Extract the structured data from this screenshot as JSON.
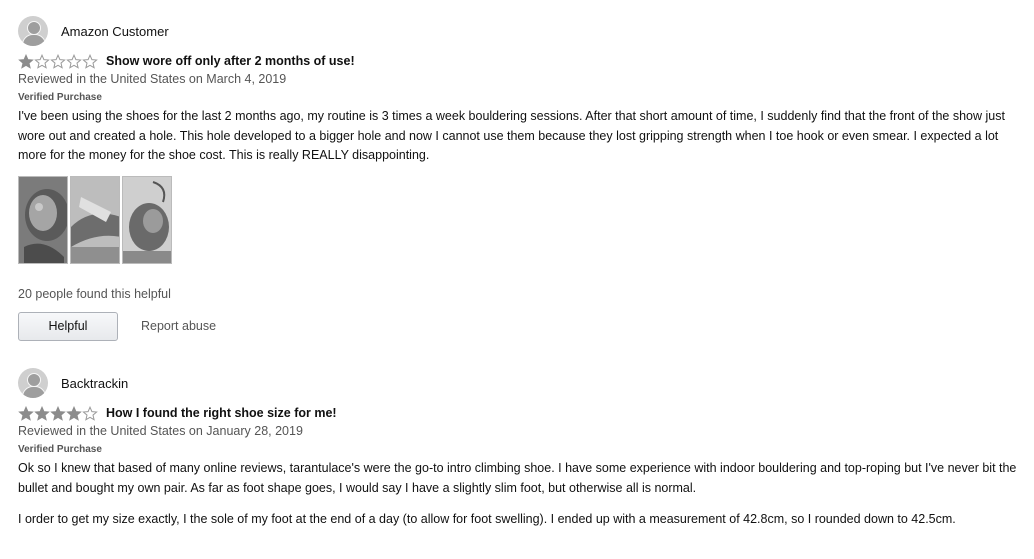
{
  "reviews": [
    {
      "author": "Amazon Customer",
      "rating": 1,
      "max_rating": 5,
      "title": "Show wore off only after 2 months of use!",
      "date_line": "Reviewed in the United States on March 4, 2019",
      "verified": "Verified Purchase",
      "body": [
        "I've been using the shoes for the last 2 months ago, my routine is 3 times a week bouldering sessions. After that short amount of time, I suddenly find that the front of the show just wore out and created a hole. This hole developed to a bigger hole and now I cannot use them because they lost gripping strength when I toe hook or even smear. I expected a lot more for the money for the shoe cost. This is really REALLY disappointing."
      ],
      "image_count": 3,
      "helpful_count_text": "20 people found this helpful",
      "helpful_label": "Helpful",
      "report_label": "Report abuse"
    },
    {
      "author": "Backtrackin",
      "rating": 4,
      "max_rating": 5,
      "title": "How I found the right shoe size for me!",
      "date_line": "Reviewed in the United States on January 28, 2019",
      "verified": "Verified Purchase",
      "body": [
        "Ok so I knew that based of many online reviews, tarantulace's were the go-to intro climbing shoe. I have some experience with indoor bouldering and top-roping but I've never bit the bullet and bought my own pair. As far as foot shape goes, I would say I have a slightly slim foot, but otherwise all is normal.",
        "I order to get my size exactly, I the sole of my foot at the end of a day (to allow for foot swelling). I ended up with a measurement of 42.8cm, so I rounded down to 42.5cm."
      ]
    }
  ],
  "colors": {
    "star_filled": "#8c8c8c",
    "star_empty_stroke": "#9a9a9a",
    "verified_text": "#555555"
  },
  "icons": {
    "avatar": "person-silhouette-icon",
    "star": "star-icon"
  }
}
